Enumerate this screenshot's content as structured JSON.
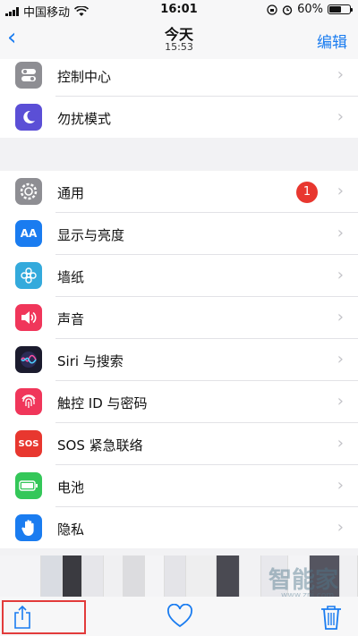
{
  "status_bar": {
    "carrier": "中国移动",
    "time": "16:01",
    "battery": "60%",
    "battery_level": 0.6
  },
  "nav": {
    "title": "今天",
    "subtitle": "15:53",
    "edit": "编辑"
  },
  "settings": {
    "group1": [
      {
        "label": "控制中心",
        "icon": "control-center-icon",
        "color": "#8e8e93"
      },
      {
        "label": "勿扰模式",
        "icon": "moon-icon",
        "color": "#5b4fd6"
      }
    ],
    "group2": [
      {
        "label": "通用",
        "icon": "gear-icon",
        "color": "#8e8e93",
        "badge": "1"
      },
      {
        "label": "显示与亮度",
        "icon": "display-icon",
        "color": "#1a7cf0",
        "glyph": "AA"
      },
      {
        "label": "墙纸",
        "icon": "flower-icon",
        "color": "#34aadc"
      },
      {
        "label": "声音",
        "icon": "speaker-icon",
        "color": "#f0365a"
      },
      {
        "label": "Siri 与搜索",
        "icon": "siri-icon",
        "color": "#1b1b2e"
      },
      {
        "label": "触控 ID 与密码",
        "icon": "fingerprint-icon",
        "color": "#f0365a"
      },
      {
        "label": "SOS 紧急联络",
        "icon": "sos-icon",
        "color": "#e8372f",
        "glyph": "SOS"
      },
      {
        "label": "电池",
        "icon": "battery-icon",
        "color": "#34c759"
      },
      {
        "label": "隐私",
        "icon": "hand-icon",
        "color": "#1a7cf0"
      }
    ]
  },
  "watermark": {
    "main": "智能家",
    "sub": "www.znj.com"
  },
  "colors": {
    "accent": "#1a7cf0",
    "highlight": "#e23b3b"
  }
}
